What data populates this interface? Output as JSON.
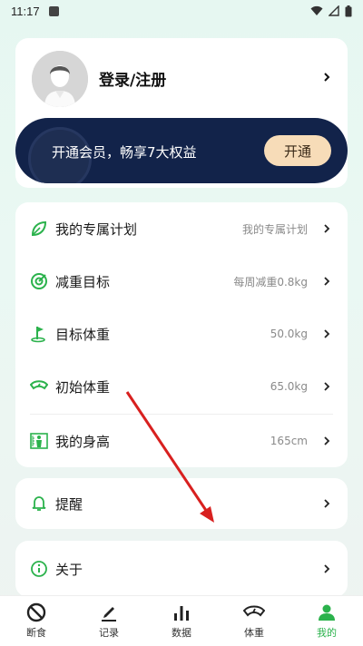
{
  "status_bar": {
    "time": "11:17"
  },
  "profile": {
    "login_label": "登录/注册"
  },
  "vip": {
    "text": "开通会员，畅享7大权益",
    "button_label": "开通"
  },
  "menu": [
    {
      "label": "我的专属计划",
      "value": "我的专属计划",
      "icon": "leaf-icon"
    },
    {
      "label": "减重目标",
      "value": "每周减重0.8kg",
      "icon": "target-icon"
    },
    {
      "label": "目标体重",
      "value": "50.0kg",
      "icon": "flag-icon"
    },
    {
      "label": "初始体重",
      "value": "65.0kg",
      "icon": "scale-icon"
    },
    {
      "label": "我的身高",
      "value": "165cm",
      "icon": "height-icon"
    }
  ],
  "remind": {
    "label": "提醒",
    "icon": "bell-icon"
  },
  "about": {
    "label": "关于",
    "icon": "info-icon"
  },
  "nav": [
    {
      "label": "断食",
      "icon": "fasting-icon"
    },
    {
      "label": "记录",
      "icon": "pencil-icon"
    },
    {
      "label": "数据",
      "icon": "bar-chart-icon"
    },
    {
      "label": "体重",
      "icon": "scale-icon"
    },
    {
      "label": "我的",
      "icon": "person-icon",
      "active": true
    }
  ],
  "colors": {
    "accent": "#2bb24c",
    "vip_bg": "#12234a",
    "vip_button": "#f7dcb8",
    "annotation_arrow": "#d8201f"
  }
}
